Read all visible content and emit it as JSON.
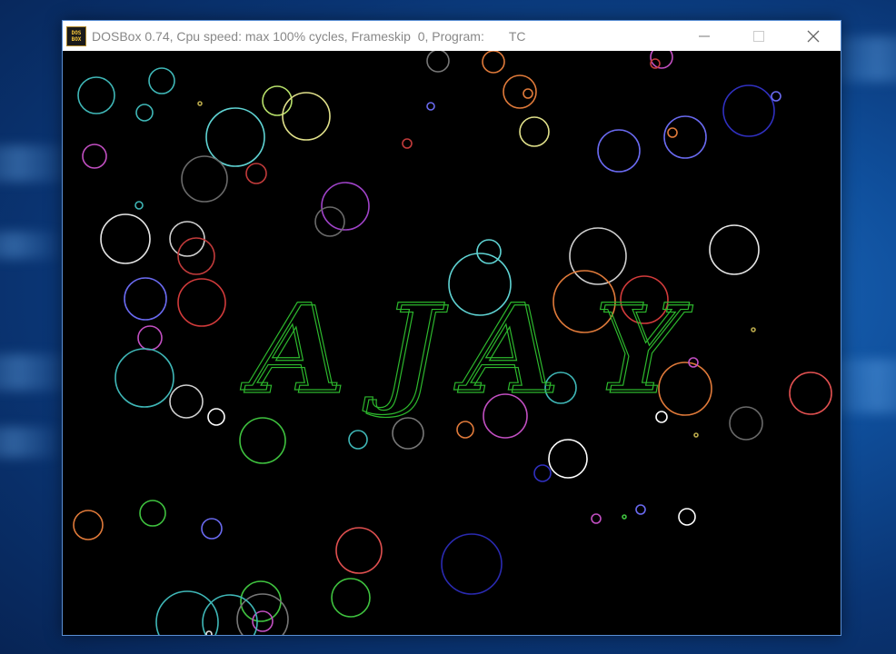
{
  "window": {
    "title": "DOSBox 0.74, Cpu speed: max 100% cycles, Frameskip  0, Program:       TC",
    "icon": "dosbox-icon",
    "icon_text_top": "DOS",
    "icon_text_bottom": "BOX",
    "controls": [
      "minimize-icon",
      "maximize-icon",
      "close-icon"
    ]
  },
  "screen": {
    "banner_text": "AJAY",
    "banner_color": "#2db82d",
    "background_color": "#000000"
  },
  "colors": {
    "desktop": "#0f4f9c",
    "titlebar": "#ffffff"
  }
}
